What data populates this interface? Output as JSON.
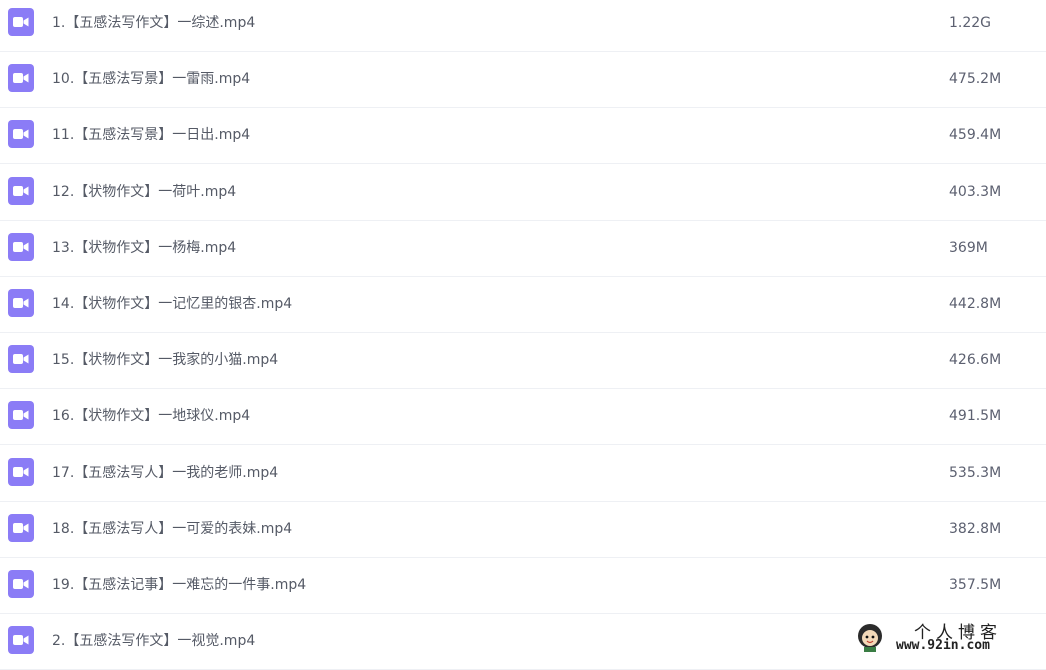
{
  "files": [
    {
      "name": "1.【五感法写作文】一综述.mp4",
      "size": "1.22G",
      "icon": "video-file-icon"
    },
    {
      "name": "10.【五感法写景】一雷雨.mp4",
      "size": "475.2M",
      "icon": "video-file-icon"
    },
    {
      "name": "11.【五感法写景】一日出.mp4",
      "size": "459.4M",
      "icon": "video-file-icon"
    },
    {
      "name": "12.【状物作文】一荷叶.mp4",
      "size": "403.3M",
      "icon": "video-file-icon"
    },
    {
      "name": "13.【状物作文】一杨梅.mp4",
      "size": "369M",
      "icon": "video-file-icon"
    },
    {
      "name": "14.【状物作文】一记忆里的银杏.mp4",
      "size": "442.8M",
      "icon": "video-file-icon"
    },
    {
      "name": "15.【状物作文】一我家的小猫.mp4",
      "size": "426.6M",
      "icon": "video-file-icon"
    },
    {
      "name": "16.【状物作文】一地球仪.mp4",
      "size": "491.5M",
      "icon": "video-file-icon"
    },
    {
      "name": "17.【五感法写人】一我的老师.mp4",
      "size": "535.3M",
      "icon": "video-file-icon"
    },
    {
      "name": "18.【五感法写人】一可爱的表妹.mp4",
      "size": "382.8M",
      "icon": "video-file-icon"
    },
    {
      "name": "19.【五感法记事】一难忘的一件事.mp4",
      "size": "357.5M",
      "icon": "video-file-icon"
    },
    {
      "name": "2.【五感法写作文】一视觉.mp4",
      "size": "",
      "icon": "video-file-icon"
    }
  ],
  "watermark": {
    "title": "个人博客",
    "url": "www.92in.com"
  },
  "colors": {
    "icon_bg": "#8b7cf6",
    "text": "#555a66",
    "divider": "#eef0f4"
  }
}
